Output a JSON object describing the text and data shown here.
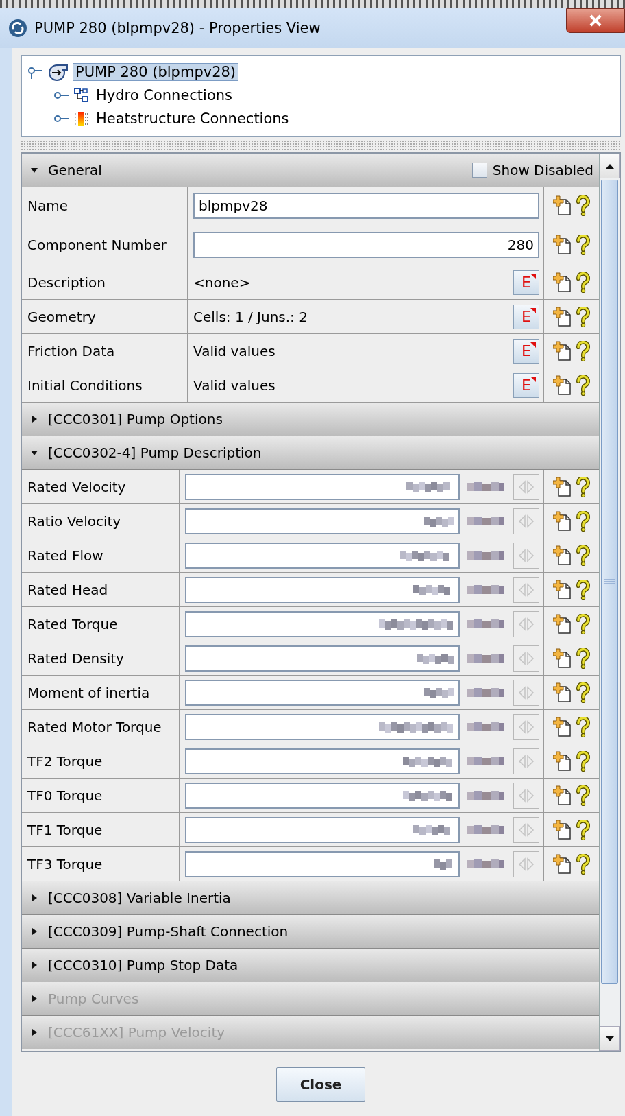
{
  "window": {
    "title": "PUMP 280 (blpmpv28) - Properties View"
  },
  "tree": {
    "label": "PUMP 280 (blpmpv28)",
    "selected": true,
    "expanded": true,
    "children": [
      {
        "label": "Hydro Connections",
        "kind": "hydro",
        "expanded": false
      },
      {
        "label": "Heatstructure Connections",
        "kind": "heat",
        "expanded": false
      }
    ]
  },
  "show_disabled": {
    "label": "Show Disabled",
    "checked": false
  },
  "sections": [
    {
      "title": "General",
      "expanded": true,
      "disabled": false,
      "rows": [
        {
          "label": "Name",
          "kind": "text",
          "value": "blpmpv28"
        },
        {
          "label": "Component Number",
          "kind": "number",
          "value": "280"
        },
        {
          "label": "Description",
          "kind": "editor",
          "value": "<none>",
          "button": "E"
        },
        {
          "label": "Geometry",
          "kind": "editor",
          "value": "Cells: 1 / Juns.: 2",
          "button": "E"
        },
        {
          "label": "Friction Data",
          "kind": "editor",
          "value": "Valid values",
          "button": "E"
        },
        {
          "label": "Initial Conditions",
          "kind": "editor",
          "value": "Valid values",
          "button": "E"
        }
      ]
    },
    {
      "title": "[CCC0301] Pump Options",
      "expanded": false,
      "disabled": false
    },
    {
      "title": "[CCC0302-4] Pump Description",
      "expanded": true,
      "disabled": false,
      "rows": [
        {
          "label": "Rated Velocity",
          "kind": "unit"
        },
        {
          "label": "Ratio Velocity",
          "kind": "unit"
        },
        {
          "label": "Rated Flow",
          "kind": "unit"
        },
        {
          "label": "Rated Head",
          "kind": "unit"
        },
        {
          "label": "Rated Torque",
          "kind": "unit"
        },
        {
          "label": "Rated Density",
          "kind": "unit"
        },
        {
          "label": "Moment of inertia",
          "kind": "unit"
        },
        {
          "label": "Rated Motor Torque",
          "kind": "unit"
        },
        {
          "label": "TF2 Torque",
          "kind": "unit"
        },
        {
          "label": "TF0 Torque",
          "kind": "unit"
        },
        {
          "label": "TF1 Torque",
          "kind": "unit"
        },
        {
          "label": "TF3 Torque",
          "kind": "unit"
        }
      ]
    },
    {
      "title": "[CCC0308] Variable Inertia",
      "expanded": false,
      "disabled": false
    },
    {
      "title": "[CCC0309] Pump-Shaft Connection",
      "expanded": false,
      "disabled": false
    },
    {
      "title": "[CCC0310] Pump Stop Data",
      "expanded": false,
      "disabled": false
    },
    {
      "title": "Pump Curves",
      "expanded": false,
      "disabled": true
    },
    {
      "title": "[CCC61XX] Pump Velocity",
      "expanded": false,
      "disabled": true
    }
  ],
  "close_button": "Close"
}
